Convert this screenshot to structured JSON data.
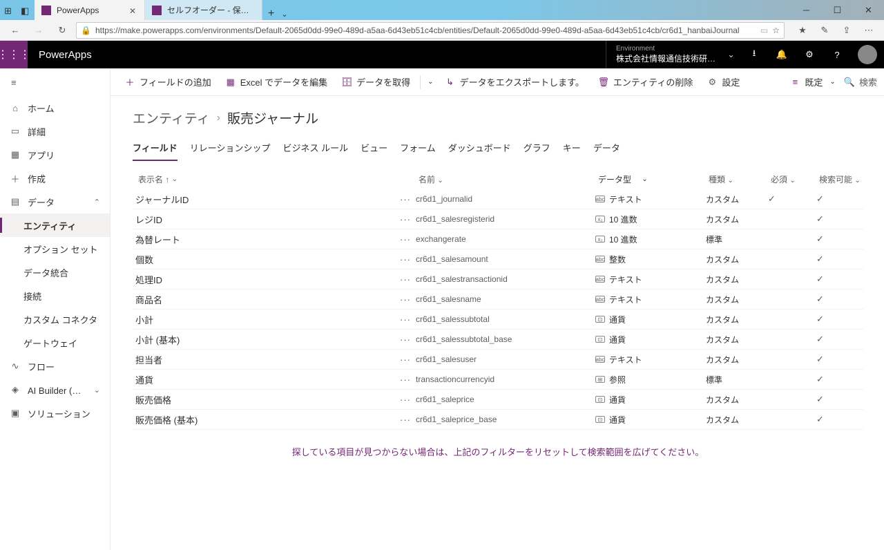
{
  "window": {
    "tab1": "PowerApps",
    "tab2": "セルフオーダー - 保存済み (発行"
  },
  "url": "https://make.powerapps.com/environments/Default-2065d0dd-99e0-489d-a5aa-6d43eb51c4cb/entities/Default-2065d0dd-99e0-489d-a5aa-6d43eb51c4cb/cr6d1_hanbaiJournal",
  "header": {
    "appname": "PowerApps",
    "env_label": "Environment",
    "env_value": "株式会社情報通信技術研究開..."
  },
  "sidebar": {
    "home": "ホーム",
    "learn": "詳細",
    "apps": "アプリ",
    "create": "作成",
    "data": "データ",
    "entities": "エンティティ",
    "optionsets": "オプション セット",
    "dataintegration": "データ統合",
    "connections": "接続",
    "customconnectors": "カスタム コネクタ",
    "gateways": "ゲートウェイ",
    "flows": "フロー",
    "aibuilder": "AI Builder (プレビュー)",
    "solutions": "ソリューション"
  },
  "cmdbar": {
    "addfield": "フィールドの追加",
    "editexcel": "Excel でデータを編集",
    "getdata": "データを取得",
    "export": "データをエクスポートします。",
    "delete": "エンティティの削除",
    "settings": "設定",
    "view": "既定",
    "search": "検索"
  },
  "breadcrumb": {
    "root": "エンティティ",
    "current": "販売ジャーナル"
  },
  "subtabs": {
    "fields": "フィールド",
    "relationships": "リレーションシップ",
    "rules": "ビジネス ルール",
    "views": "ビュー",
    "forms": "フォーム",
    "dashboards": "ダッシュボード",
    "charts": "グラフ",
    "keys": "キー",
    "data": "データ"
  },
  "gridhead": {
    "display": "表示名 ↑",
    "name": "名前",
    "type": "データ型",
    "cat": "種類",
    "req": "必須",
    "search": "検索可能"
  },
  "rows": [
    {
      "display": "ジャーナルID",
      "name": "cr6d1_journalid",
      "type": "テキスト",
      "typeicon": "abc",
      "cat": "カスタム",
      "req": "✓",
      "search": "✓"
    },
    {
      "display": "レジID",
      "name": "cr6d1_salesregisterid",
      "type": "10 進数",
      "typeicon": "x2",
      "cat": "カスタム",
      "req": "",
      "search": "✓"
    },
    {
      "display": "為替レート",
      "name": "exchangerate",
      "type": "10 進数",
      "typeicon": "x2",
      "cat": "標準",
      "req": "",
      "search": "✓"
    },
    {
      "display": "個数",
      "name": "cr6d1_salesamount",
      "type": "整数",
      "typeicon": "abc",
      "cat": "カスタム",
      "req": "",
      "search": "✓"
    },
    {
      "display": "処理ID",
      "name": "cr6d1_salestransactionid",
      "type": "テキスト",
      "typeicon": "abc",
      "cat": "カスタム",
      "req": "",
      "search": "✓"
    },
    {
      "display": "商品名",
      "name": "cr6d1_salesname",
      "type": "テキスト",
      "typeicon": "abc",
      "cat": "カスタム",
      "req": "",
      "search": "✓"
    },
    {
      "display": "小計",
      "name": "cr6d1_salessubtotal",
      "type": "通貨",
      "typeicon": "cur",
      "cat": "カスタム",
      "req": "",
      "search": "✓"
    },
    {
      "display": "小計 (基本)",
      "name": "cr6d1_salessubtotal_base",
      "type": "通貨",
      "typeicon": "cur",
      "cat": "カスタム",
      "req": "",
      "search": "✓"
    },
    {
      "display": "担当者",
      "name": "cr6d1_salesuser",
      "type": "テキスト",
      "typeicon": "abc",
      "cat": "カスタム",
      "req": "",
      "search": "✓"
    },
    {
      "display": "通貨",
      "name": "transactioncurrencyid",
      "type": "参照",
      "typeicon": "ref",
      "cat": "標準",
      "req": "",
      "search": "✓"
    },
    {
      "display": "販売価格",
      "name": "cr6d1_saleprice",
      "type": "通貨",
      "typeicon": "cur",
      "cat": "カスタム",
      "req": "",
      "search": "✓"
    },
    {
      "display": "販売価格 (基本)",
      "name": "cr6d1_saleprice_base",
      "type": "通貨",
      "typeicon": "cur",
      "cat": "カスタム",
      "req": "",
      "search": "✓"
    }
  ],
  "filterhint": "探している項目が見つからない場合は、上記のフィルターをリセットして検索範囲を広げてください。"
}
